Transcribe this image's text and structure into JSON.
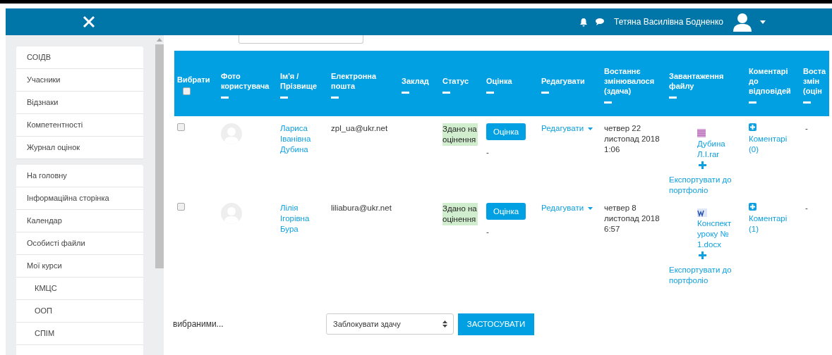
{
  "navbar": {
    "user_name": "Тетяна Василівна Бодненко"
  },
  "sidebar": {
    "groups": [
      {
        "items": [
          {
            "label": "СОІДВ"
          },
          {
            "label": "Учасники"
          },
          {
            "label": "Відзнаки"
          },
          {
            "label": "Компетентності"
          },
          {
            "label": "Журнал оцінок"
          }
        ]
      },
      {
        "items": [
          {
            "label": "На головну"
          },
          {
            "label": "Інформаційна сторінка"
          },
          {
            "label": "Календар"
          },
          {
            "label": "Особисті файли"
          },
          {
            "label": "Мої курси",
            "children": [
              {
                "label": "КМЦС"
              },
              {
                "label": "ООП"
              },
              {
                "label": "СПІМ"
              }
            ]
          }
        ]
      }
    ]
  },
  "table": {
    "select_all": {
      "checked": false
    },
    "columns": [
      "Вибрати",
      "Фото користувача",
      "Ім'я / Прізвище",
      "Електронна пошта",
      "Заклад",
      "Статус",
      "Оцінка",
      "Редагувати",
      "Востаннє змінювалося (здача)",
      "Завантаження файлу",
      "Коментарі до відповідей",
      "Воста змін (оцін"
    ],
    "rows": [
      {
        "checked": false,
        "name": "Лариса Іванівна Дубина",
        "email": "zpl_ua@ukr.net",
        "status": "Здано на оцінення",
        "grade_button": "Оцінка",
        "grade": "-",
        "edit": "Редагувати",
        "modified": "четвер 22 листопад 2018 1:06",
        "file": {
          "kind": "archive",
          "name": "Дубина Л.І.rar"
        },
        "export": "Експортувати до портфоліо",
        "comments": "Коментарі (0)",
        "last": "-"
      },
      {
        "checked": false,
        "name": "Лілія Ігорівна Бура",
        "email": "liliabura@ukr.net",
        "status": "Здано на оцінення",
        "grade_button": "Оцінка",
        "grade": "-",
        "edit": "Редагувати",
        "modified": "четвер 8 листопад 2018 6:57",
        "file": {
          "kind": "word",
          "name": "Конспект уроку № 1.docx"
        },
        "export": "Експортувати до портфоліо",
        "comments": "Коментарі (1)",
        "last": "-"
      }
    ]
  },
  "bulk": {
    "label": "вибраними...",
    "action": "Заблокувати здачу",
    "apply": "ЗАСТОСУВАТИ"
  }
}
